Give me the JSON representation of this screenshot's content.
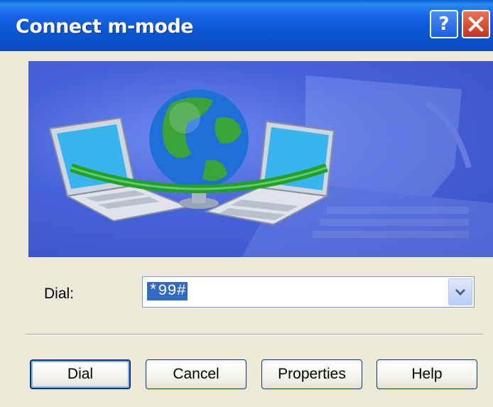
{
  "window": {
    "title": "Connect m-mode",
    "help_icon": "question-mark",
    "close_icon": "x-close"
  },
  "banner": {
    "image": "network-globe-laptops-illustration"
  },
  "dial": {
    "label": "Dial:",
    "value": "*99#"
  },
  "buttons": {
    "dial": "Dial",
    "cancel": "Cancel",
    "properties": "Properties",
    "help": "Help"
  },
  "colors": {
    "titlebar": "#0b57d4",
    "selection": "#316ac5",
    "dialog_bg": "#ece9d8"
  }
}
